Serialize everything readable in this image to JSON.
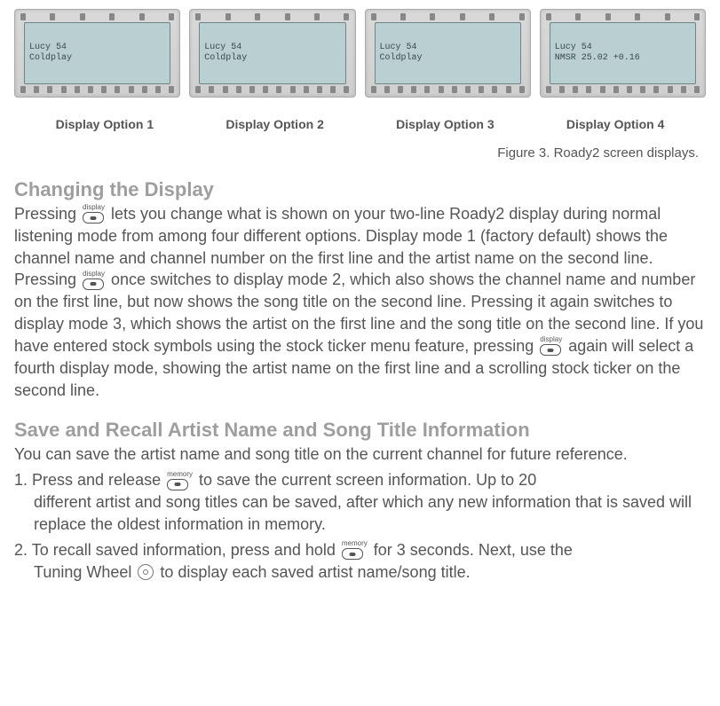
{
  "displays": [
    {
      "caption": "Display Option 1",
      "line1": "Lucy          54",
      "line2": "     Coldplay"
    },
    {
      "caption": "Display Option 2",
      "line1": "Lucy          54",
      "line2": "     Coldplay"
    },
    {
      "caption": "Display Option 3",
      "line1": "Lucy          54",
      "line2": "     Coldplay"
    },
    {
      "caption": "Display Option 4",
      "line1": "Lucy          54",
      "line2": "NMSR 25.02 +0.16"
    }
  ],
  "figure_caption": "Figure 3. Roady2  screen displays.",
  "section1": {
    "heading": "Changing the Display",
    "text_a": "Pressing ",
    "text_b": " lets you change what is shown on your two-line Roady2 display during normal listening mode from among four different options. Display mode 1 (factory default) shows the channel name and channel number on the first line and the artist name on the second line. Pressing ",
    "text_c": " once switches to display mode 2, which also shows the channel name and number on the first line, but now shows the song title on the second line. Pressing it again switches to display mode 3, which shows the artist on the first line and the song title on the second line. If you have entered stock symbols using the stock ticker menu feature, pressing ",
    "text_d": " again will select a fourth display mode, showing the artist name on the first line and a scrolling stock ticker on the second line."
  },
  "btn_labels": {
    "display": "display",
    "memory": "memory"
  },
  "section2": {
    "heading": "Save and Recall Artist Name and Song Title Information",
    "intro": "You can save the artist name and song title on the current channel for future reference.",
    "step1_a": "1. Press and release ",
    "step1_b": " to save the current screen information. Up to 20",
    "step1_c": "different artist and song titles can be saved, after which any new information that is saved will replace the oldest information in memory.",
    "step2_a": "2. To recall saved information, press and hold ",
    "step2_b": " for 3 seconds. Next, use the",
    "step2_c_a": "Tuning Wheel ",
    "step2_c_b": " to display each saved artist name/song title."
  }
}
